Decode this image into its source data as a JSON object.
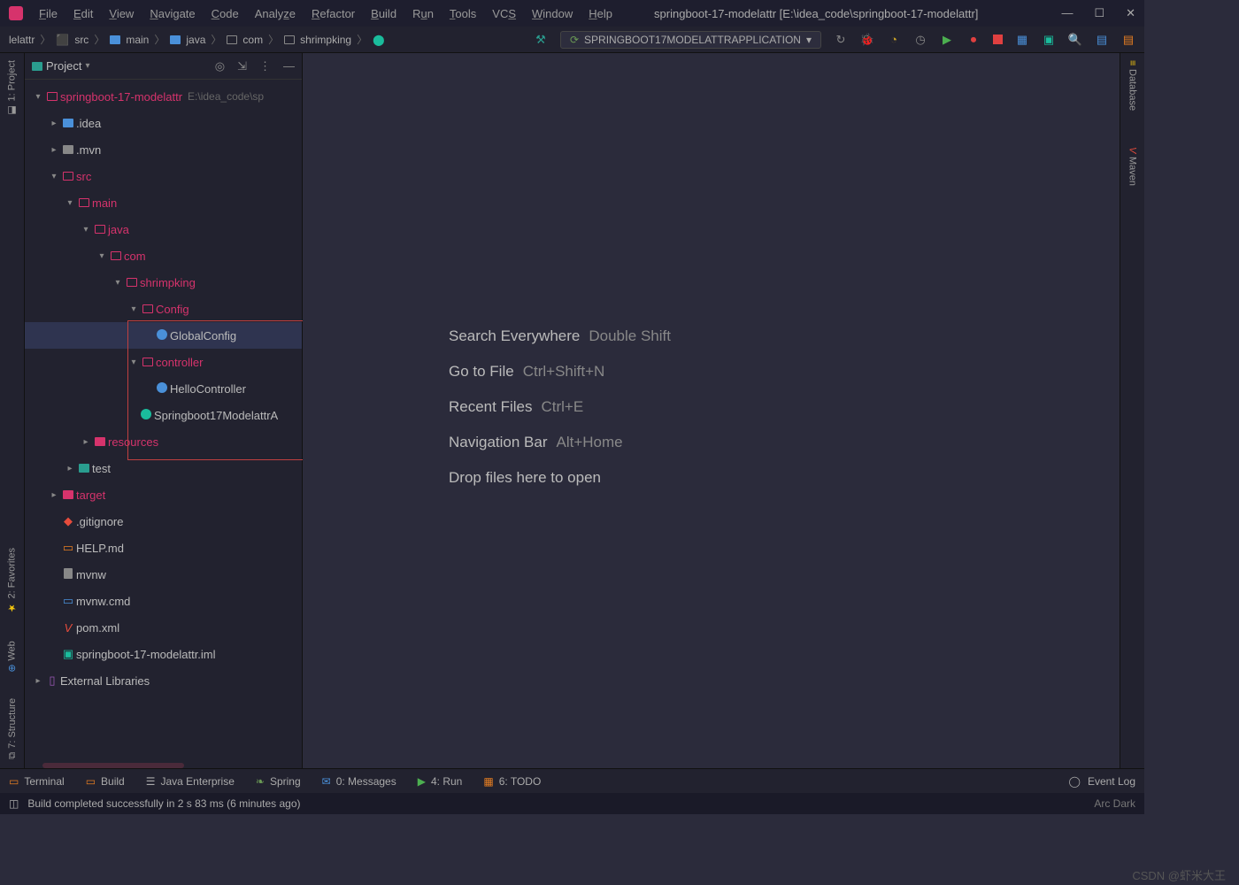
{
  "title": "springboot-17-modelattr [E:\\idea_code\\springboot-17-modelattr]",
  "menu": [
    "File",
    "Edit",
    "View",
    "Navigate",
    "Code",
    "Analyze",
    "Refactor",
    "Build",
    "Run",
    "Tools",
    "VCS",
    "Window",
    "Help"
  ],
  "breadcrumb": [
    "lelattr",
    "src",
    "main",
    "java",
    "com",
    "shrimpking"
  ],
  "run_config": "SPRINGBOOT17MODELATTRAPPLICATION",
  "sidebar_title": "Project",
  "tree": {
    "root": {
      "label": "springboot-17-modelattr",
      "extra": "E:\\idea_code\\sp"
    },
    "idea": ".idea",
    "mvn": ".mvn",
    "src": "src",
    "main": "main",
    "java": "java",
    "com": "com",
    "shrimpking": "shrimpking",
    "config": "Config",
    "globalconfig": "GlobalConfig",
    "controller": "controller",
    "hellocontroller": "HelloController",
    "app": "Springboot17ModelattrA",
    "resources": "resources",
    "test": "test",
    "target": "target",
    "gitignore": ".gitignore",
    "helpmd": "HELP.md",
    "mvnw": "mvnw",
    "mvnwcmd": "mvnw.cmd",
    "pomxml": "pom.xml",
    "iml": "springboot-17-modelattr.iml",
    "extlib": "External Libraries"
  },
  "hints": [
    {
      "label": "Search Everywhere",
      "key": "Double Shift"
    },
    {
      "label": "Go to File",
      "key": "Ctrl+Shift+N"
    },
    {
      "label": "Recent Files",
      "key": "Ctrl+E"
    },
    {
      "label": "Navigation Bar",
      "key": "Alt+Home"
    },
    {
      "label": "Drop files here to open",
      "key": ""
    }
  ],
  "left_tabs": [
    "1: Project",
    "2: Favorites",
    "Web",
    "7: Structure"
  ],
  "right_tabs": [
    "Database",
    "Maven"
  ],
  "bottom_tabs": [
    "Terminal",
    "Build",
    "Java Enterprise",
    "Spring",
    "0: Messages",
    "4: Run",
    "6: TODO"
  ],
  "event_log": "Event Log",
  "status": "Build completed successfully in 2 s 83 ms (6 minutes ago)",
  "theme": "Arc Dark",
  "watermark": "CSDN @虾米大王"
}
